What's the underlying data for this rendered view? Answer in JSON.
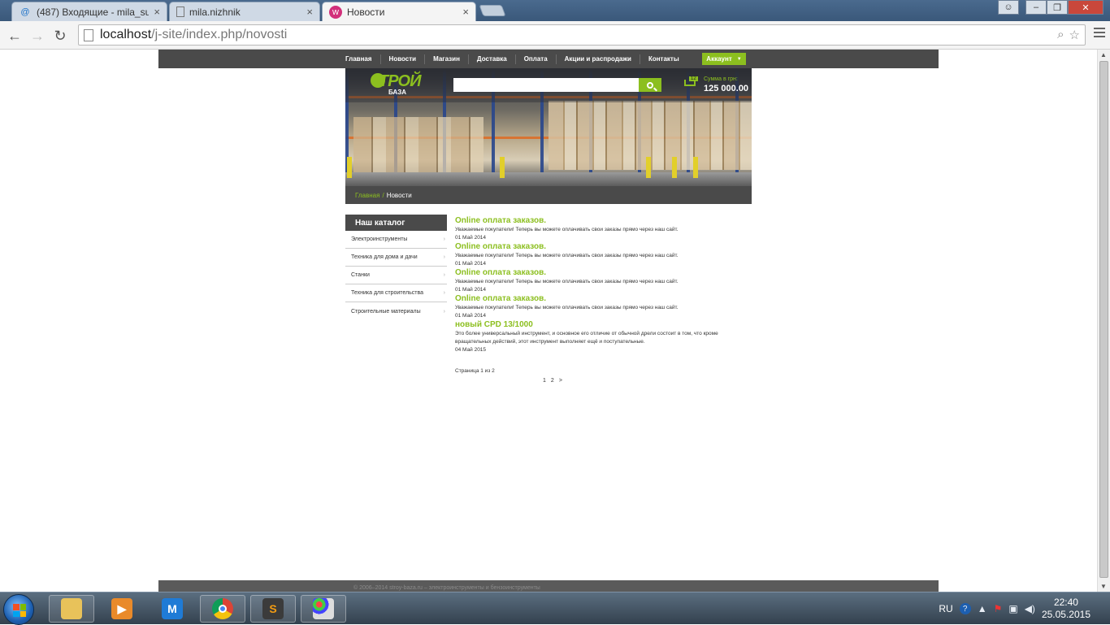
{
  "browser": {
    "tabs": [
      {
        "label": "(487) Входящие - mila_su",
        "icon": "mail-icon",
        "active": false
      },
      {
        "label": "mila.nizhnik",
        "icon": "page-icon",
        "active": false
      },
      {
        "label": "Новости",
        "icon": "site-favicon",
        "active": true
      }
    ],
    "url_host": "localhost",
    "url_path": "/j-site/index.php/novosti"
  },
  "site": {
    "nav": [
      "Главная",
      "Новости",
      "Магазин",
      "Доставка",
      "Оплата",
      "Акции и распродажи",
      "Контакты"
    ],
    "account_label": "Аккаунт",
    "logo_top": "ТРОЙ",
    "logo_bottom": "БАЗА",
    "search_placeholder": "",
    "cart_count": "12",
    "cart_label": "Сумма в грн:",
    "cart_sum": "125 000.00",
    "breadcrumb": {
      "home": "Главная",
      "separator": "/",
      "current": "Новости"
    },
    "catalog": {
      "title": "Наш каталог",
      "items": [
        "Электроинструменты",
        "Техника для дома и дачи",
        "Станки",
        "Техника для строительства",
        "Строительные материалы"
      ]
    },
    "news": [
      {
        "title": "Online оплата заказов.",
        "text": "Уважаемые покупатели! Теперь вы можете оплачивать свои заказы прямо через наш сайт.",
        "date": "01 Май 2014"
      },
      {
        "title": "Online оплата заказов.",
        "text": "Уважаемые покупатели! Теперь вы можете оплачивать свои заказы прямо через наш сайт.",
        "date": "01 Май 2014"
      },
      {
        "title": "Online оплата заказов.",
        "text": "Уважаемые покупатели! Теперь вы можете оплачивать свои заказы прямо через наш сайт.",
        "date": "01 Май 2014"
      },
      {
        "title": "Online оплата заказов.",
        "text": "Уважаемые покупатели! Теперь вы можете оплачивать свои заказы прямо через наш сайт.",
        "date": "01 Май 2014"
      },
      {
        "title": "новый CPD 13/1000",
        "text": "Это более универсальный инструмент, и основное его отличие от обычной дрели состоит в том, что кроме вращательных действий, этот инструмент выполняет ещё и поступательные.",
        "date": "04 Май 2015"
      }
    ],
    "page_info": "Страница 1 из 2",
    "pager": [
      "1",
      "2",
      ">"
    ],
    "footer": "© 2006–2014 stroy-baza.ru – электроинструменты и бензоинструменты"
  },
  "taskbar": {
    "apps": [
      "explorer-icon",
      "media-player-icon",
      "maxthon-icon",
      "chrome-icon",
      "sublime-icon",
      "paint-icon"
    ],
    "lang": "RU",
    "time": "22:40",
    "date": "25.05.2015"
  },
  "colors": {
    "accent": "#8cbf1f",
    "bar": "#4a4a4a"
  }
}
